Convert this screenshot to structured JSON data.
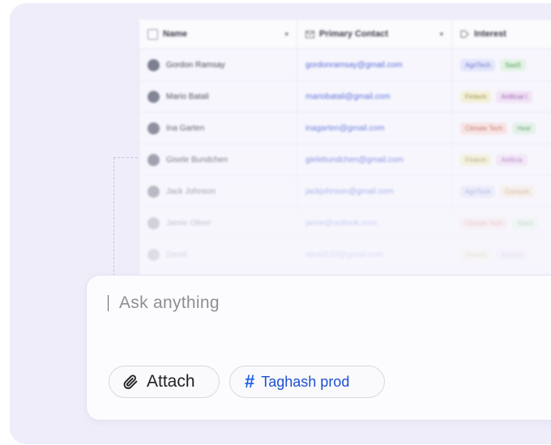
{
  "table": {
    "columns": [
      {
        "label": "Name",
        "icon": "checkbox-icon"
      },
      {
        "label": "Primary Contact",
        "icon": "email-icon"
      },
      {
        "label": "Interest",
        "icon": "tag-icon"
      }
    ],
    "rows": [
      {
        "name": "Gordon Ramsay",
        "email": "gordonramsay@gmail.com",
        "tags": [
          "AgriTech",
          "SaaS"
        ],
        "opacity": 1
      },
      {
        "name": "Mario Batali",
        "email": "mariobatali@gmail.com",
        "tags": [
          "Fintech",
          "Artificial I"
        ],
        "opacity": 0.95
      },
      {
        "name": "Ina Garten",
        "email": "inagarten@gmail.com",
        "tags": [
          "Climate Tech",
          "Heal"
        ],
        "opacity": 0.85
      },
      {
        "name": "Gisele Bundchen",
        "email": "gielebundchen@gmail.com",
        "tags": [
          "Fintech",
          "Artificia"
        ],
        "opacity": 0.7
      },
      {
        "name": "Jack Johnson",
        "email": "jackjohnson@gmail.com",
        "tags": [
          "AgriTech",
          "Consum"
        ],
        "opacity": 0.5
      },
      {
        "name": "Jamie Oliver",
        "email": "jamie@outlook.com",
        "tags": [
          "Climate Tech",
          "SaaS"
        ],
        "opacity": 0.3
      },
      {
        "name": "David",
        "email": "david123@gmail.com",
        "tags": [
          "Fintech",
          "Automo"
        ],
        "opacity": 0.2
      }
    ],
    "tag_colors": {
      "AgriTech": [
        "#e3e6fb",
        "#6b76c9"
      ],
      "SaaS": [
        "#e3f3e4",
        "#4f9a5a"
      ],
      "Fintech": [
        "#f4f0d8",
        "#9a8a3a"
      ],
      "Artificial I": [
        "#f1e3f6",
        "#9a5cb0"
      ],
      "Artificia": [
        "#f1e3f6",
        "#9a5cb0"
      ],
      "Climate Tech": [
        "#f8e2e0",
        "#c0645a"
      ],
      "Heal": [
        "#e2f1e7",
        "#4f9a5a"
      ],
      "Consum": [
        "#f6eadc",
        "#b07a44"
      ],
      "Automo": [
        "#f1e3f6",
        "#9a5cb0"
      ]
    }
  },
  "input": {
    "placeholder": "Ask anything"
  },
  "buttons": {
    "attach_label": "Attach",
    "context_label": "Taghash prod",
    "context_symbol": "#"
  },
  "colors": {
    "frame_bg": "#efedfa",
    "accent": "#1e60e8"
  }
}
